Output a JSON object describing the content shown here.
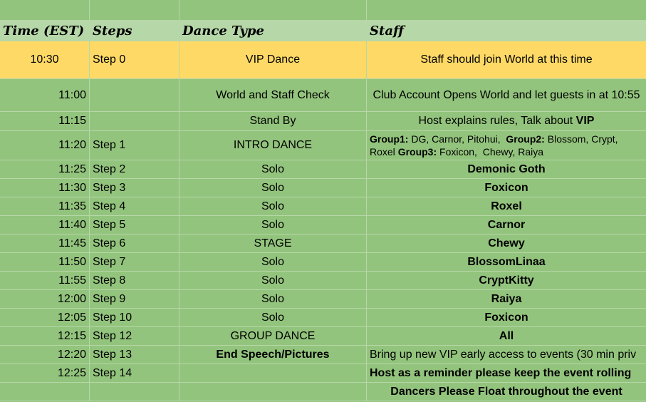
{
  "headers": {
    "time": "Time (EST)",
    "steps": "Steps",
    "dance": "Dance Type",
    "staff": "Staff"
  },
  "rows": [
    {
      "time": "10:30",
      "step": "Step 0",
      "dance": "VIP Dance",
      "staff": "Staff should join World at this time"
    },
    {
      "time": "11:00",
      "step": "",
      "dance": "World and Staff Check",
      "staff": "Club Account Opens World and let guests in at 10:55"
    },
    {
      "time": "11:15",
      "step": "",
      "dance": "Stand By",
      "staff_pre": "Host explains rules, Talk about ",
      "staff_bold": "VIP"
    },
    {
      "time": "11:20",
      "step": "Step 1",
      "dance": "INTRO DANCE",
      "staff_groups": {
        "g1_label": "Group1:",
        "g1": " DG, Carnor, Pitohui,  ",
        "g2_label": "Group2:",
        "g2": " Blossom, Crypt, Roxel ",
        "g3_label": "Group3:",
        "g3": " Foxicon,  Chewy, Raiya"
      }
    },
    {
      "time": "11:25",
      "step": "Step 2",
      "dance": "Solo",
      "staff": "Demonic Goth"
    },
    {
      "time": "11:30",
      "step": "Step 3",
      "dance": "Solo",
      "staff": "Foxicon"
    },
    {
      "time": "11:35",
      "step": "Step 4",
      "dance": "Solo",
      "staff": "Roxel"
    },
    {
      "time": "11:40",
      "step": "Step 5",
      "dance": "Solo",
      "staff": "Carnor"
    },
    {
      "time": "11:45",
      "step": "Step 6",
      "dance": "STAGE",
      "staff": "Chewy"
    },
    {
      "time": "11:50",
      "step": "Step 7",
      "dance": "Solo",
      "staff": "BlossomLinaa"
    },
    {
      "time": "11:55",
      "step": "Step 8",
      "dance": "Solo",
      "staff": "CryptKitty"
    },
    {
      "time": "12:00",
      "step": "Step 9",
      "dance": "Solo",
      "staff": "Raiya"
    },
    {
      "time": "12:05",
      "step": "Step 10",
      "dance": "Solo",
      "staff": "Foxicon"
    },
    {
      "time": "12:15",
      "step": "Step 12",
      "dance": "GROUP DANCE",
      "staff": "All"
    },
    {
      "time": "12:20",
      "step": "Step 13",
      "dance": "End Speech/Pictures",
      "staff": "Bring up new VIP early access to events (30 min priv"
    },
    {
      "time": "12:25",
      "step": "Step 14",
      "dance": "",
      "staff": "Host as a reminder please keep the event rolling"
    },
    {
      "time": "",
      "step": "",
      "dance": "",
      "staff": "Dancers Please Float throughout the event"
    }
  ]
}
